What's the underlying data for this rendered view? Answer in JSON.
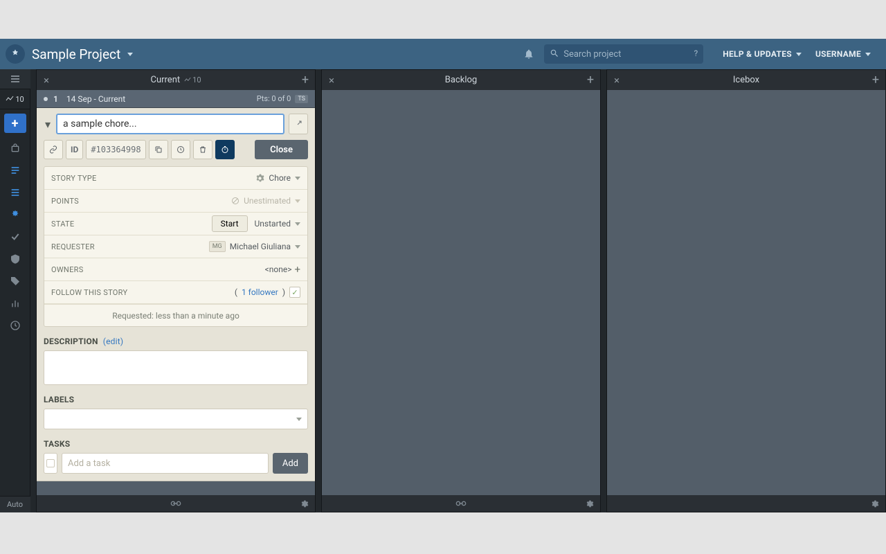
{
  "header": {
    "project_title": "Sample Project",
    "search_placeholder": "Search project",
    "help_label": "HELP & UPDATES",
    "username_label": "USERNAME"
  },
  "leftbar": {
    "velocity": "10",
    "auto_label": "Auto"
  },
  "panels": {
    "current": {
      "title": "Current",
      "velocity": "10"
    },
    "backlog": {
      "title": "Backlog"
    },
    "icebox": {
      "title": "Icebox"
    }
  },
  "iteration": {
    "number": "1",
    "date_label": "14 Sep - Current",
    "points_label": "Pts: 0 of 0",
    "ts_badge": "TS"
  },
  "story": {
    "title": "a sample chore...",
    "id_label": "ID",
    "id_value": "#103364998",
    "close_label": "Close",
    "fields": {
      "story_type_label": "STORY TYPE",
      "story_type_value": "Chore",
      "points_label": "POINTS",
      "points_value": "Unestimated",
      "state_label": "STATE",
      "state_value": "Unstarted",
      "start_btn": "Start",
      "requester_label": "REQUESTER",
      "requester_initials": "MG",
      "requester_name": "Michael Giuliana",
      "owners_label": "OWNERS",
      "owners_value": "<none>",
      "follow_label": "FOLLOW THIS STORY",
      "follower_text": "1 follower",
      "requested_text": "Requested: less than a minute ago"
    },
    "description": {
      "label": "DESCRIPTION",
      "edit": "(edit)"
    },
    "labels": {
      "label": "LABELS"
    },
    "tasks": {
      "label": "TASKS",
      "placeholder": "Add a task",
      "add_btn": "Add"
    }
  }
}
